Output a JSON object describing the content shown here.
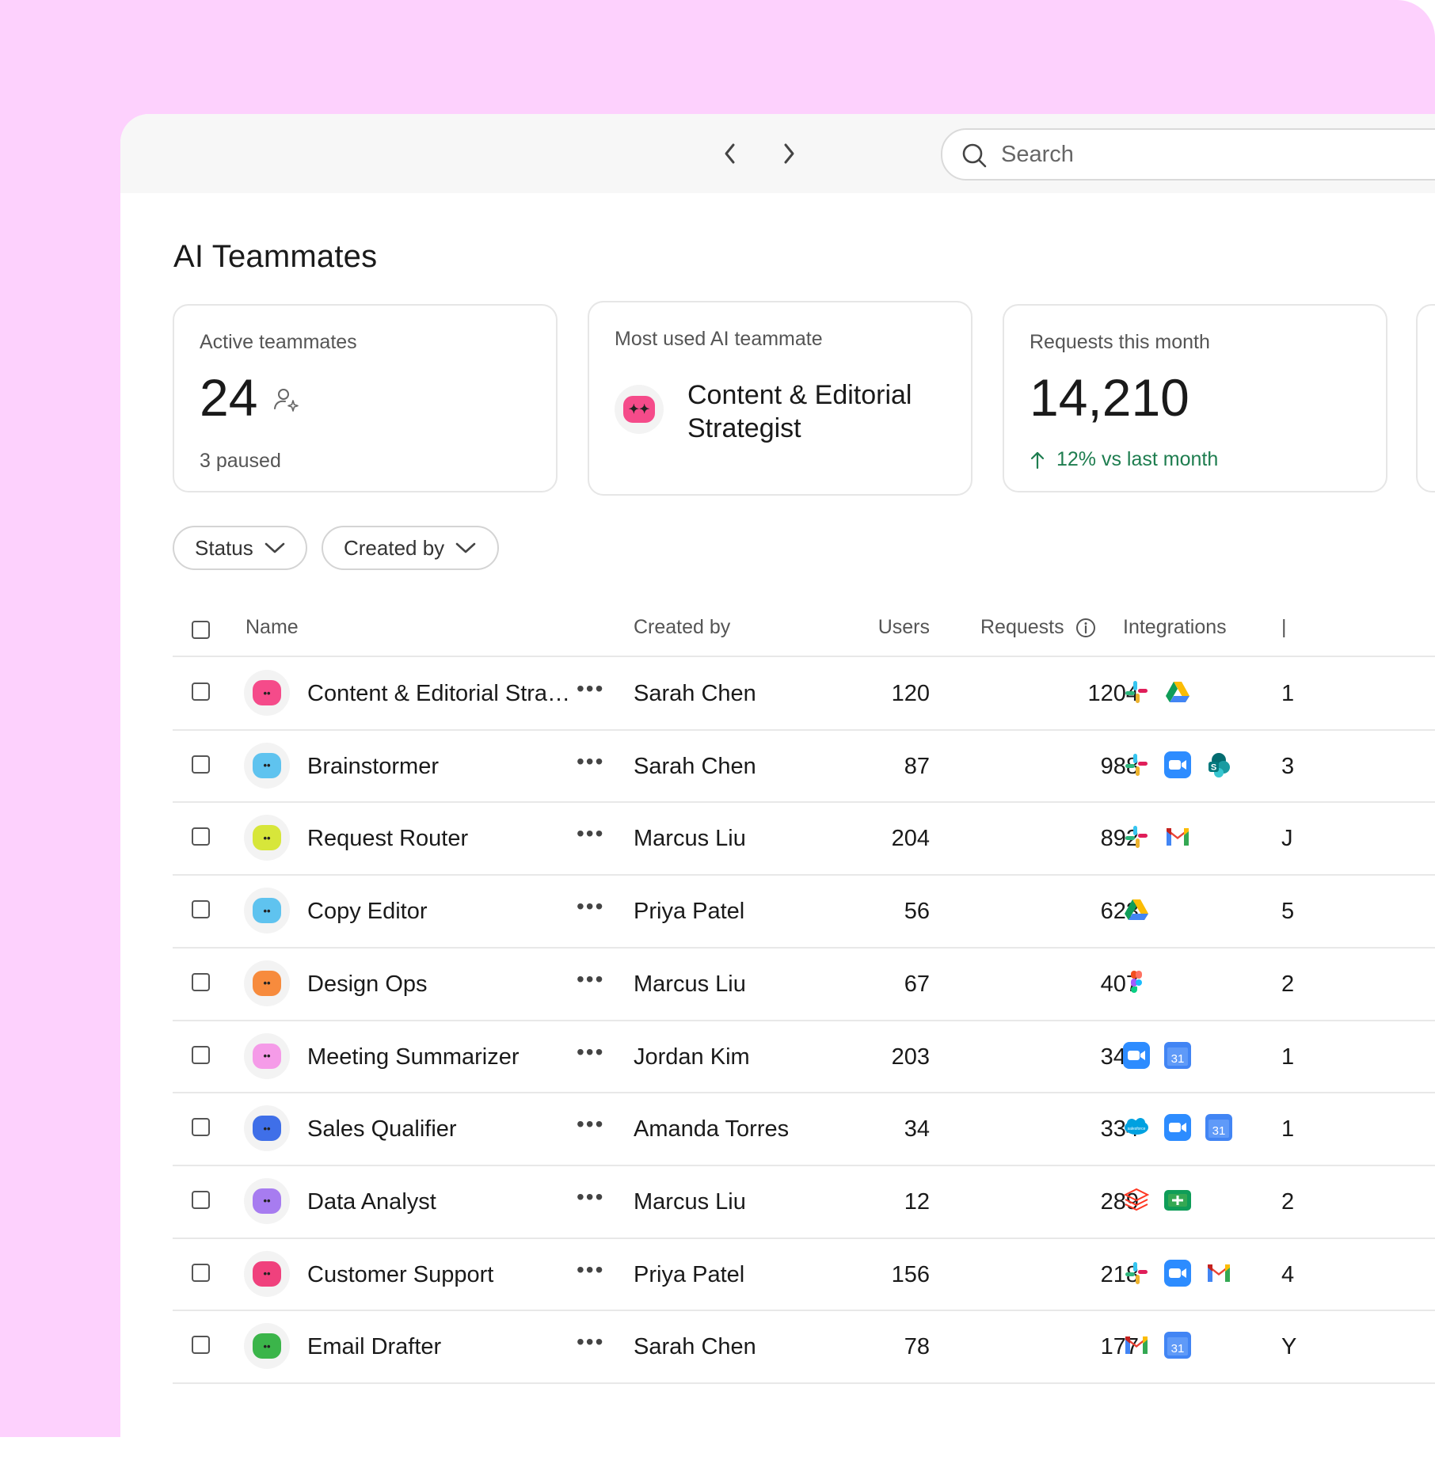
{
  "nav": {
    "back_icon": "chevron-left-icon",
    "forward_icon": "chevron-right-icon"
  },
  "search": {
    "placeholder": "Search",
    "icon": "search-icon"
  },
  "page": {
    "title": "AI Teammates"
  },
  "cards": {
    "active": {
      "label": "Active teammates",
      "value": "24",
      "sub": "3 paused",
      "icon": "user-sparkle-icon"
    },
    "most_used": {
      "label": "Most used AI teammate",
      "name": "Content & Editorial Strategist"
    },
    "requests": {
      "label": "Requests this month",
      "value": "14,210",
      "trend": "12% vs last month",
      "trend_color": "#1e7d4f"
    }
  },
  "filters": {
    "status": "Status",
    "created_by": "Created by"
  },
  "table": {
    "headers": {
      "name": "Name",
      "created_by": "Created by",
      "users": "Users",
      "requests": "Requests",
      "integrations": "Integrations"
    },
    "rows": [
      {
        "name": "Content & Editorial Strateg...",
        "created_by": "Sarah Chen",
        "users": "120",
        "requests": "1204",
        "avatar_color": "#f54b8a",
        "integrations": [
          "slack-icon",
          "google-drive-icon"
        ],
        "trailing": "1"
      },
      {
        "name": "Brainstormer",
        "created_by": "Sarah Chen",
        "users": "87",
        "requests": "988",
        "avatar_color": "#5fc3ef",
        "integrations": [
          "slack-icon",
          "zoom-icon",
          "sharepoint-icon"
        ],
        "trailing": "3"
      },
      {
        "name": "Request Router",
        "created_by": "Marcus Liu",
        "users": "204",
        "requests": "892",
        "avatar_color": "#d7e63a",
        "integrations": [
          "slack-icon",
          "gmail-icon"
        ],
        "trailing": "J"
      },
      {
        "name": "Copy Editor",
        "created_by": "Priya Patel",
        "users": "56",
        "requests": "623",
        "avatar_color": "#5fc3ef",
        "integrations": [
          "google-drive-icon"
        ],
        "trailing": "5"
      },
      {
        "name": "Design Ops",
        "created_by": "Marcus Liu",
        "users": "67",
        "requests": "407",
        "avatar_color": "#f78b3d",
        "integrations": [
          "figma-icon"
        ],
        "trailing": "2"
      },
      {
        "name": "Meeting Summarizer",
        "created_by": "Jordan Kim",
        "users": "203",
        "requests": "341",
        "avatar_color": "#f59be8",
        "integrations": [
          "zoom-icon",
          "google-calendar-icon"
        ],
        "trailing": "1"
      },
      {
        "name": "Sales Qualifier",
        "created_by": "Amanda Torres",
        "users": "34",
        "requests": "334",
        "avatar_color": "#3f6fe8",
        "integrations": [
          "salesforce-icon",
          "zoom-icon",
          "google-calendar-icon"
        ],
        "trailing": "1"
      },
      {
        "name": "Data Analyst",
        "created_by": "Marcus Liu",
        "users": "12",
        "requests": "289",
        "avatar_color": "#a77cf0",
        "integrations": [
          "databricks-icon",
          "google-sheets-icon"
        ],
        "trailing": "2"
      },
      {
        "name": "Customer Support",
        "created_by": "Priya Patel",
        "users": "156",
        "requests": "218",
        "avatar_color": "#f0417d",
        "integrations": [
          "slack-icon",
          "zoom-icon",
          "gmail-icon"
        ],
        "trailing": "4"
      },
      {
        "name": "Email Drafter",
        "created_by": "Sarah Chen",
        "users": "78",
        "requests": "177",
        "avatar_color": "#3bb54a",
        "integrations": [
          "gmail-icon",
          "google-calendar-icon"
        ],
        "trailing": "Y"
      }
    ]
  }
}
